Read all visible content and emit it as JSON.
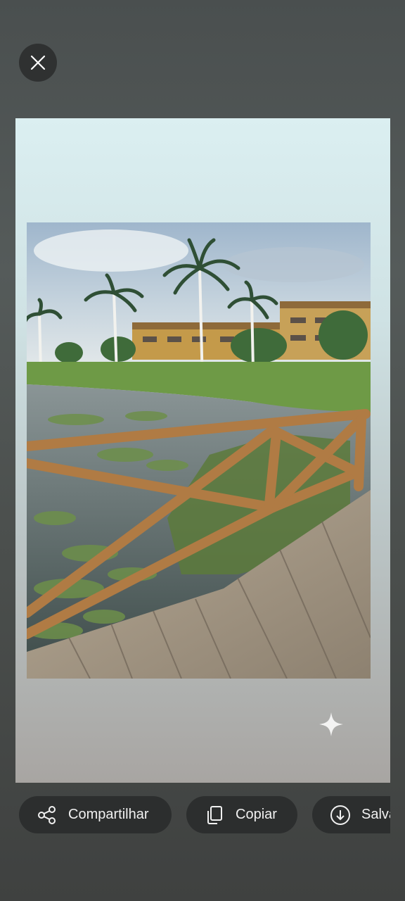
{
  "close": {
    "icon": "close-icon"
  },
  "preview": {
    "image": "lakeside-boardwalk-photo",
    "badge_icon": "sparkle-icon"
  },
  "actions": [
    {
      "label": "Compartilhar",
      "icon": "share-icon"
    },
    {
      "label": "Copiar",
      "icon": "copy-icon"
    },
    {
      "label": "Salvar",
      "icon": "download-icon"
    }
  ],
  "colors": {
    "overlay": "#4e5352",
    "button": "#2c2e2e",
    "text": "#f1f1f1"
  }
}
